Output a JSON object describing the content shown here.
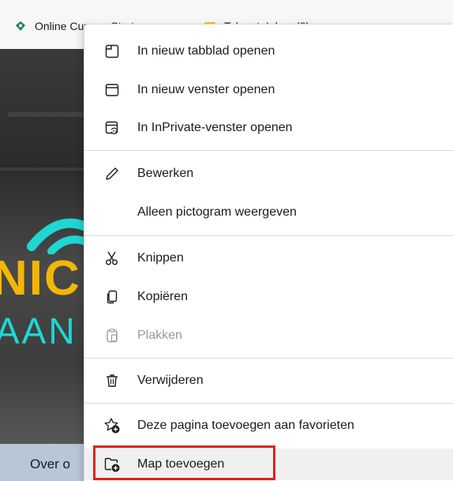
{
  "favorites_bar": {
    "items": [
      {
        "label": "Online Cursus: Start",
        "icon": "shield-icon"
      },
      {
        "label": "Telenet: Inbox (8)",
        "icon": "mail-icon"
      }
    ]
  },
  "page": {
    "nav_label": "Over o",
    "logo_line1": "NIC",
    "logo_line2": "AAN"
  },
  "context_menu": {
    "groups": [
      [
        {
          "label": "In nieuw tabblad openen",
          "icon": "new-tab-icon",
          "enabled": true
        },
        {
          "label": "In nieuw venster openen",
          "icon": "new-window-icon",
          "enabled": true
        },
        {
          "label": "In InPrivate-venster openen",
          "icon": "inprivate-window-icon",
          "enabled": true
        }
      ],
      [
        {
          "label": "Bewerken",
          "icon": "pencil-icon",
          "enabled": true
        },
        {
          "label": "Alleen pictogram weergeven",
          "icon": "",
          "enabled": true
        }
      ],
      [
        {
          "label": "Knippen",
          "icon": "scissors-icon",
          "enabled": true
        },
        {
          "label": "Kopiëren",
          "icon": "copy-icon",
          "enabled": true
        },
        {
          "label": "Plakken",
          "icon": "paste-icon",
          "enabled": false
        }
      ],
      [
        {
          "label": "Verwijderen",
          "icon": "trash-icon",
          "enabled": true
        }
      ],
      [
        {
          "label": "Deze pagina toevoegen aan favorieten",
          "icon": "add-favorite-icon",
          "enabled": true
        },
        {
          "label": "Map toevoegen",
          "icon": "add-folder-icon",
          "enabled": true,
          "hovered": true
        }
      ]
    ]
  },
  "colors": {
    "highlight_border": "#e0201e",
    "disabled_text": "#9a9a9a",
    "logo_yellow": "#f2b705",
    "logo_cyan": "#1fd6d3"
  }
}
